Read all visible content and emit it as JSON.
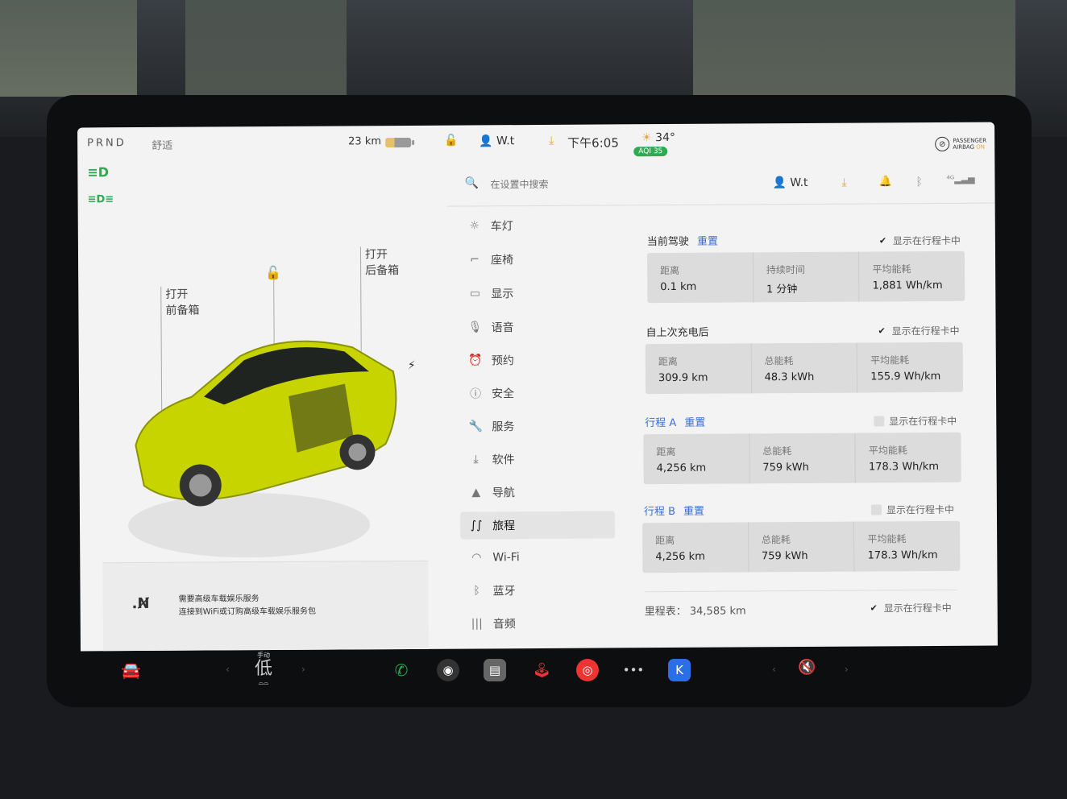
{
  "status": {
    "prnd": "PRND",
    "drive_mode": "舒适",
    "range": "23 km",
    "user": "W.t",
    "time": "下午6:05",
    "temp": "34°",
    "aqi": "AQI 35",
    "airbag_l1": "PASSENGER",
    "airbag_l2": "AIRBAG",
    "airbag_state": "ON"
  },
  "car_panel": {
    "frunk_l1": "打开",
    "frunk_l2": "前备箱",
    "trunk_l1": "打开",
    "trunk_l2": "后备箱",
    "car_color": "#c8d400",
    "notice_l1": "需要高级车载娱乐服务",
    "notice_l2": "连接到WiFi或订购高级车载娱乐服务包"
  },
  "search": {
    "placeholder": "在设置中搜索"
  },
  "header": {
    "user": "W.t"
  },
  "menu": [
    {
      "icon": "light-icon",
      "label": "车灯"
    },
    {
      "icon": "seat-icon",
      "label": "座椅"
    },
    {
      "icon": "display-icon",
      "label": "显示"
    },
    {
      "icon": "mic-icon",
      "label": "语音"
    },
    {
      "icon": "alarm-icon",
      "label": "预约"
    },
    {
      "icon": "safety-icon",
      "label": "安全"
    },
    {
      "icon": "wrench-icon",
      "label": "服务"
    },
    {
      "icon": "download-icon",
      "label": "软件"
    },
    {
      "icon": "nav-icon",
      "label": "导航"
    },
    {
      "icon": "trip-icon",
      "label": "旅程",
      "active": true
    },
    {
      "icon": "wifi-icon",
      "label": "Wi-Fi"
    },
    {
      "icon": "bluetooth-icon",
      "label": "蓝牙"
    },
    {
      "icon": "audio-icon",
      "label": "音频"
    }
  ],
  "show_label": "显示在行程卡中",
  "reset_label": "重置",
  "trips": {
    "current": {
      "title": "当前驾驶",
      "show_checked": true,
      "stats": [
        {
          "label": "距离",
          "value": "0.1 km"
        },
        {
          "label": "持续时间",
          "value": "1 分钟"
        },
        {
          "label": "平均能耗",
          "value": "1,881 Wh/km"
        }
      ]
    },
    "since_charge": {
      "title": "自上次充电后",
      "show_checked": true,
      "stats": [
        {
          "label": "距离",
          "value": "309.9 km"
        },
        {
          "label": "总能耗",
          "value": "48.3 kWh"
        },
        {
          "label": "平均能耗",
          "value": "155.9 Wh/km"
        }
      ]
    },
    "trip_a": {
      "title": "行程 A",
      "show_checked": false,
      "stats": [
        {
          "label": "距离",
          "value": "4,256 km"
        },
        {
          "label": "总能耗",
          "value": "759 kWh"
        },
        {
          "label": "平均能耗",
          "value": "178.3 Wh/km"
        }
      ]
    },
    "trip_b": {
      "title": "行程 B",
      "show_checked": false,
      "stats": [
        {
          "label": "距离",
          "value": "4,256 km"
        },
        {
          "label": "总能耗",
          "value": "759 kWh"
        },
        {
          "label": "平均能耗",
          "value": "178.3 Wh/km"
        }
      ]
    }
  },
  "odometer": {
    "label": "里程表：",
    "value": "34,585 km"
  },
  "dock": {
    "fan_mode": "手动",
    "fan_level": "低"
  },
  "colors": {
    "accent_blue": "#3b6fd6",
    "green": "#2faa52",
    "orange": "#e8a73a"
  }
}
